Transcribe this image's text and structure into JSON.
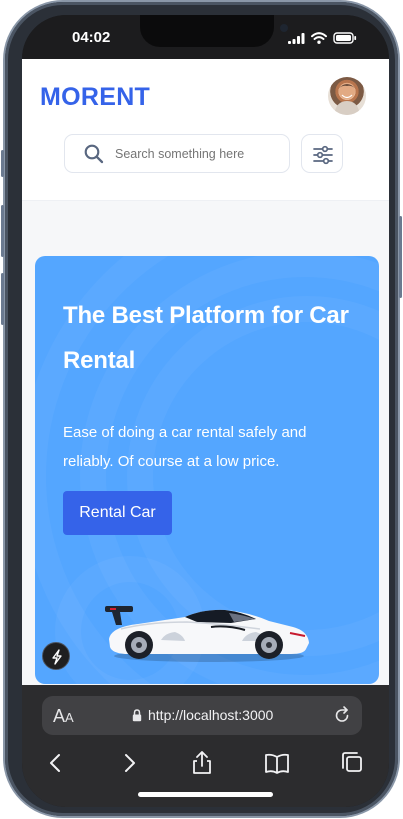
{
  "status_bar": {
    "time": "04:02"
  },
  "app": {
    "logo": "MORENT",
    "search": {
      "placeholder": "Search something here"
    },
    "hero": {
      "title": "The Best Platform for Car Rental",
      "description": "Ease of doing a car rental safely and reliably. Of course at a low price.",
      "button_label": "Rental Car"
    }
  },
  "browser": {
    "text_size_button": {
      "large": "A",
      "small": "A"
    },
    "url": "http://localhost:3000"
  },
  "colors": {
    "brand": "#3563e9",
    "hero_background": "#54a6ff",
    "browser_chrome": "#2c2c2e"
  },
  "icons": {
    "status": [
      "signal-icon",
      "wifi-icon",
      "battery-icon"
    ],
    "header": [
      "avatar",
      "search-icon",
      "filter-icon"
    ],
    "browser": [
      "lock-icon",
      "reload-icon",
      "back-icon",
      "forward-icon",
      "share-icon",
      "bookmarks-icon",
      "tabs-icon"
    ]
  }
}
